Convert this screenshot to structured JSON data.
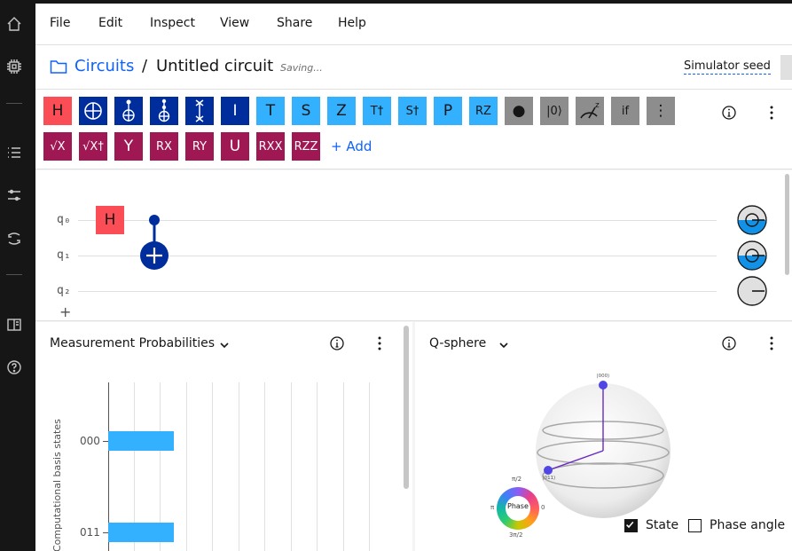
{
  "menu": {
    "items": [
      "File",
      "Edit",
      "Inspect",
      "View",
      "Share",
      "Help"
    ]
  },
  "breadcrumb": {
    "folder": "Circuits",
    "separator": "/",
    "title": "Untitled circuit",
    "status": "Saving...",
    "simulator_seed": "Simulator seed"
  },
  "palette": {
    "row1": [
      {
        "label": "H",
        "color": "#fa4d56",
        "text": "#161616",
        "icon": ""
      },
      {
        "label": "",
        "color": "#002d9c",
        "text": "#ffffff",
        "icon": "cnot-icon"
      },
      {
        "label": "",
        "color": "#002d9c",
        "text": "#ffffff",
        "icon": "toffoli-icon"
      },
      {
        "label": "",
        "color": "#002d9c",
        "text": "#ffffff",
        "icon": "ccc-x-icon"
      },
      {
        "label": "",
        "color": "#002d9c",
        "text": "#ffffff",
        "icon": "swap-icon"
      },
      {
        "label": "I",
        "color": "#002d9c",
        "text": "#ffffff",
        "icon": ""
      },
      {
        "label": "T",
        "color": "#33b1ff",
        "text": "#161616",
        "icon": ""
      },
      {
        "label": "S",
        "color": "#33b1ff",
        "text": "#161616",
        "icon": ""
      },
      {
        "label": "Z",
        "color": "#33b1ff",
        "text": "#161616",
        "icon": ""
      },
      {
        "label": "T†",
        "color": "#33b1ff",
        "text": "#161616",
        "icon": ""
      },
      {
        "label": "S†",
        "color": "#33b1ff",
        "text": "#161616",
        "icon": ""
      },
      {
        "label": "P",
        "color": "#33b1ff",
        "text": "#161616",
        "icon": ""
      },
      {
        "label": "RZ",
        "color": "#33b1ff",
        "text": "#161616",
        "icon": ""
      },
      {
        "label": "●",
        "color": "#8d8d8d",
        "text": "#161616",
        "icon": ""
      },
      {
        "label": "|0⟩",
        "color": "#8d8d8d",
        "text": "#161616",
        "icon": ""
      },
      {
        "label": "",
        "color": "#8d8d8d",
        "text": "#161616",
        "icon": "measure-icon"
      },
      {
        "label": "if",
        "color": "#8d8d8d",
        "text": "#161616",
        "icon": ""
      },
      {
        "label": "⋮",
        "color": "#8d8d8d",
        "text": "#161616",
        "icon": ""
      }
    ],
    "row2": [
      {
        "label": "√X",
        "color": "#9f1853",
        "text": "#ffffff"
      },
      {
        "label": "√X†",
        "color": "#9f1853",
        "text": "#ffffff"
      },
      {
        "label": "Y",
        "color": "#9f1853",
        "text": "#ffffff"
      },
      {
        "label": "RX",
        "color": "#9f1853",
        "text": "#ffffff"
      },
      {
        "label": "RY",
        "color": "#9f1853",
        "text": "#ffffff"
      },
      {
        "label": "U",
        "color": "#9f1853",
        "text": "#ffffff"
      },
      {
        "label": "RXX",
        "color": "#9f1853",
        "text": "#ffffff"
      },
      {
        "label": "RZZ",
        "color": "#9f1853",
        "text": "#ffffff"
      }
    ],
    "add_label": "+ Add"
  },
  "composer": {
    "qubits": [
      "q₀",
      "q₁",
      "q₂"
    ],
    "placed_gate": "H",
    "add_qubit": "+"
  },
  "probabilities": {
    "title": "Measurement Probabilities",
    "ylabel": "Computational basis states",
    "chart_data": {
      "type": "bar",
      "orientation": "horizontal",
      "categories": [
        "000",
        "011"
      ],
      "values": [
        50,
        50
      ],
      "ylabel": "Computational basis states"
    }
  },
  "qsphere": {
    "title": "Q-sphere",
    "state_labels": [
      "|000⟩",
      "|011⟩"
    ],
    "phase": {
      "center": "Phase",
      "top": "π/2",
      "left": "π",
      "right": "0",
      "bottom": "3π/2"
    },
    "state_checkbox": "State",
    "phase_angle_checkbox": "Phase angle",
    "state_checked": true,
    "phase_angle_checked": false
  }
}
